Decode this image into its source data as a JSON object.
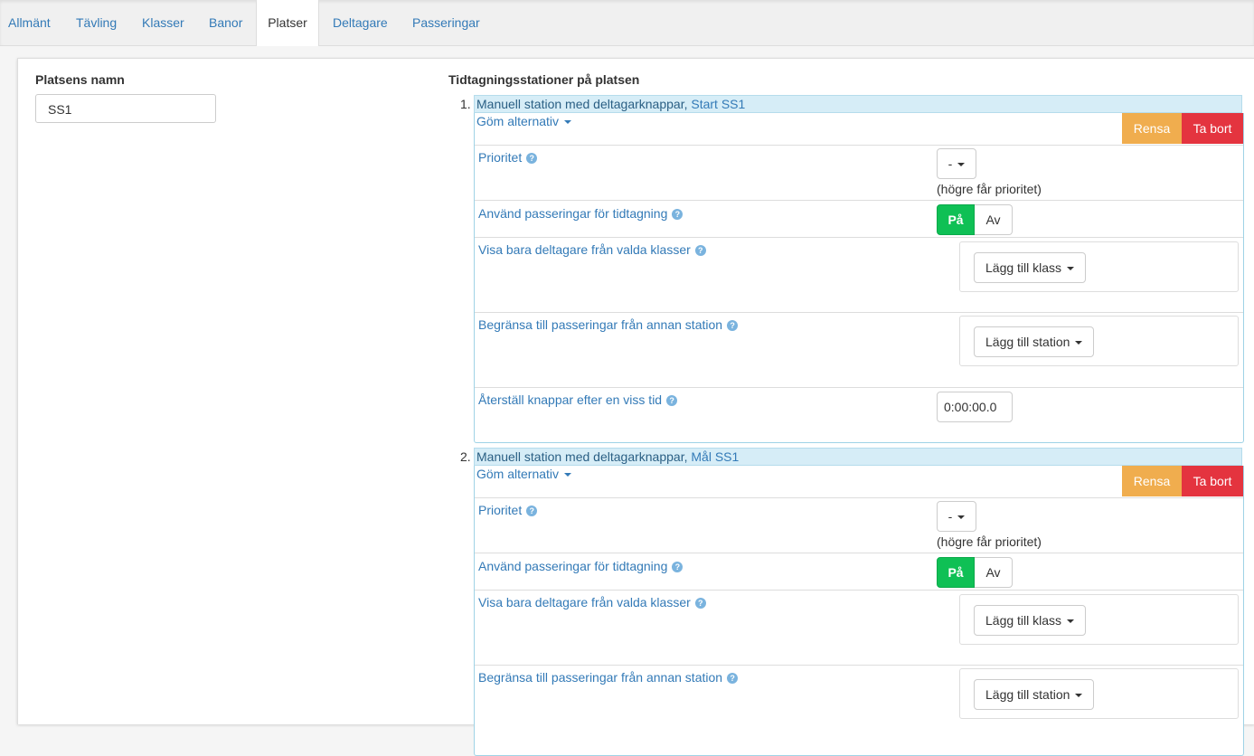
{
  "tabs": [
    {
      "label": "Allmänt"
    },
    {
      "label": "Tävling"
    },
    {
      "label": "Klasser"
    },
    {
      "label": "Banor"
    },
    {
      "label": "Platser"
    },
    {
      "label": "Deltagare"
    },
    {
      "label": "Passeringar"
    }
  ],
  "active_tab": "Platser",
  "left": {
    "name_label": "Platsens namn",
    "name_value": "SS1"
  },
  "right": {
    "heading": "Tidtagningsstationer på platsen",
    "stations": [
      {
        "number": "1.",
        "type": "Manuell station med deltagarknappar,",
        "name": "Start SS1",
        "hide_options": "Göm alternativ",
        "btn_clear": "Rensa",
        "btn_delete": "Ta bort",
        "priority_label": "Prioritet",
        "priority_value": "-",
        "priority_hint": "(högre får prioritet)",
        "use_passings_label": "Använd passeringar för tidtagning",
        "toggle_on": "På",
        "toggle_off": "Av",
        "classes_label": "Visa bara deltagare från valda klasser",
        "add_class": "Lägg till klass",
        "limit_label": "Begränsa till passeringar från annan station",
        "add_station": "Lägg till station",
        "reset_label": "Återställ knappar efter en viss tid",
        "reset_value": "0:00:00.0"
      },
      {
        "number": "2.",
        "type": "Manuell station med deltagarknappar,",
        "name": "Mål SS1",
        "hide_options": "Göm alternativ",
        "btn_clear": "Rensa",
        "btn_delete": "Ta bort",
        "priority_label": "Prioritet",
        "priority_value": "-",
        "priority_hint": "(högre får prioritet)",
        "use_passings_label": "Använd passeringar för tidtagning",
        "toggle_on": "På",
        "toggle_off": "Av",
        "classes_label": "Visa bara deltagare från valda klasser",
        "add_class": "Lägg till klass",
        "limit_label": "Begränsa till passeringar från annan station",
        "add_station": "Lägg till station"
      }
    ]
  },
  "colors": {
    "link": "#337ab7",
    "rensa": "#f0ad4e",
    "ta_bort": "#e4343f",
    "toggle_on": "#0fc055",
    "station_header": "#d6edf7"
  }
}
